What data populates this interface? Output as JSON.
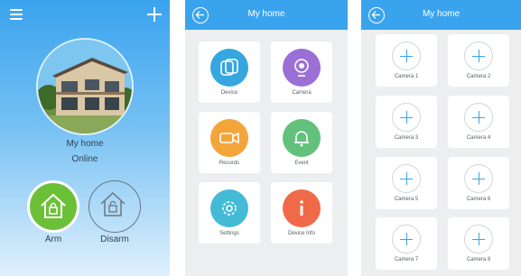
{
  "colors": {
    "accent": "#3aa3ee",
    "arm_green": "#6cc038",
    "device": "#35a6df",
    "camera": "#9b6fd6",
    "records": "#f3a53a",
    "event": "#62c27b",
    "settings": "#43bbd6",
    "device_info": "#f06a4a"
  },
  "home": {
    "name": "My home",
    "status": "Online",
    "arm_label": "Arm",
    "disarm_label": "Disarm",
    "menu_icon": "hamburger-menu-icon",
    "add_icon": "plus-icon"
  },
  "devices_screen": {
    "title": "My home",
    "tiles": [
      {
        "label": "Device",
        "icon": "device-icon"
      },
      {
        "label": "Camera",
        "icon": "camera-icon"
      },
      {
        "label": "Records",
        "icon": "records-icon"
      },
      {
        "label": "Event",
        "icon": "bell-icon"
      },
      {
        "label": "Settings",
        "icon": "gear-icon"
      },
      {
        "label": "Device Info",
        "icon": "info-icon"
      }
    ]
  },
  "cameras_screen": {
    "title": "My home",
    "cameras": [
      "Camera 1",
      "Camera 2",
      "Camera 3",
      "Camera 4",
      "Camera 5",
      "Camera 6",
      "Camera 7",
      "Camera 8"
    ]
  }
}
